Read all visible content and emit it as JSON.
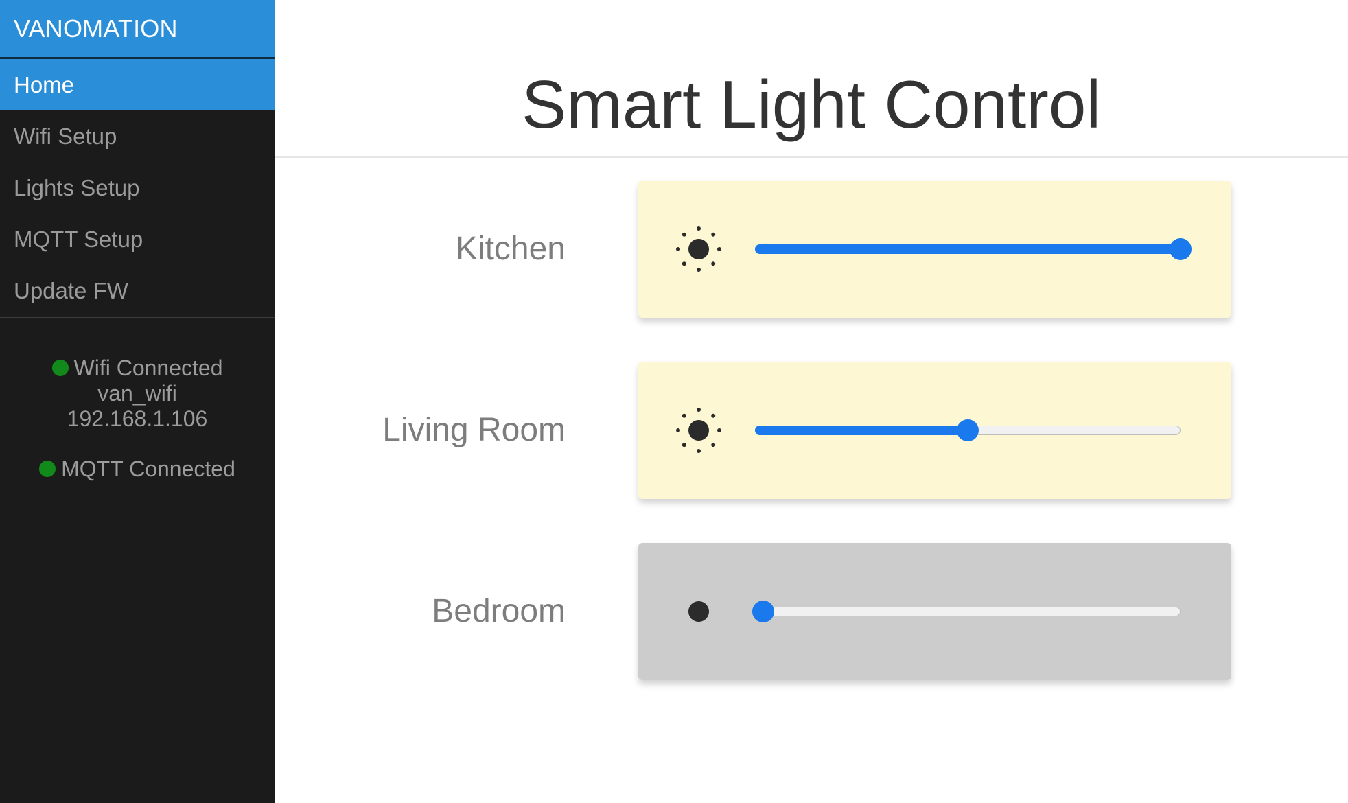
{
  "app": {
    "brand": "VANOMATION"
  },
  "sidebar": {
    "items": [
      {
        "label": "Home",
        "active": true
      },
      {
        "label": "Wifi Setup",
        "active": false
      },
      {
        "label": "Lights Setup",
        "active": false
      },
      {
        "label": "MQTT Setup",
        "active": false
      },
      {
        "label": "Update FW",
        "active": false
      }
    ],
    "status": {
      "wifi": {
        "label": "Wifi Connected",
        "ssid": "van_wifi",
        "ip": "192.168.1.106",
        "indicator_color": "#128a1b"
      },
      "mqtt": {
        "label": "MQTT Connected",
        "indicator_color": "#128a1b"
      }
    }
  },
  "main": {
    "title": "Smart Light Control",
    "lights": [
      {
        "name": "Kitchen",
        "on": true,
        "brightness_fraction": 1.0,
        "icon": "sun-icon"
      },
      {
        "name": "Living Room",
        "on": true,
        "brightness_fraction": 0.5,
        "icon": "sun-icon"
      },
      {
        "name": "Bedroom",
        "on": false,
        "brightness_fraction": 0.02,
        "icon": "dot-icon"
      }
    ]
  },
  "colors": {
    "accent": "#2a8fd8",
    "slider": "#1a79ec",
    "card_on": "#fdf8d3",
    "card_off": "#cccccc",
    "sidebar_bg": "#1b1b1b"
  }
}
